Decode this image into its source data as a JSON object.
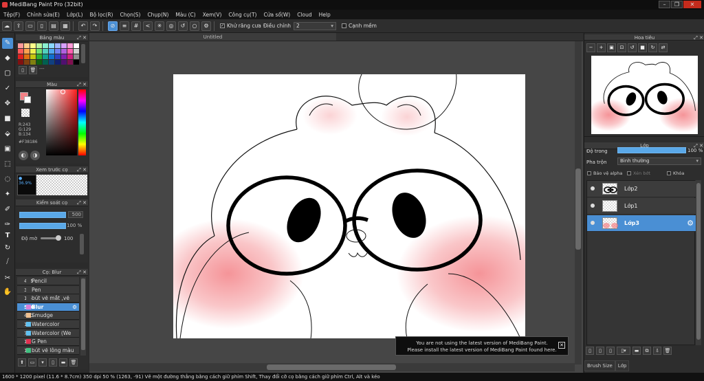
{
  "app": {
    "title": "MediBang Paint Pro (32bit)",
    "window_buttons": [
      "–",
      "❐",
      "✕"
    ]
  },
  "menu": [
    "Tệp(F)",
    "Chỉnh sửa(E)",
    "Lớp(L)",
    "Bộ lọc(R)",
    "Chọn(S)",
    "Chụp(N)",
    "Màu (C)",
    "Xem(V)",
    "Công cụ(T)",
    "Cửa sổ(W)",
    "Cloud",
    "Help"
  ],
  "toolbar": {
    "antialias_label": "Khử răng cưa",
    "correction_label": "Điều chỉnh",
    "correction_value": "2",
    "snap_label": "Cạnh mềm"
  },
  "color_panel": {
    "title": "Bảng màu",
    "swatches": [
      "#ff9a9a",
      "#ffd08a",
      "#ffff8a",
      "#b8f5a0",
      "#8af0d0",
      "#8ad8ff",
      "#a0b4ff",
      "#d8a0ff",
      "#ff9ad8",
      "#ffffff",
      "#ff5a5a",
      "#ffa050",
      "#f0f050",
      "#70e070",
      "#50d0c0",
      "#50a8f0",
      "#7080f0",
      "#b060e0",
      "#ff60b0",
      "#d0d0d0",
      "#e02020",
      "#e07010",
      "#c8c810",
      "#30b030",
      "#10a090",
      "#1070d0",
      "#3040c0",
      "#8020b0",
      "#d02080",
      "#909090",
      "#801010",
      "#804010",
      "#808010",
      "#106010",
      "#006050",
      "#104080",
      "#102070",
      "#501070",
      "#801050",
      "#000000"
    ]
  },
  "hue_panel": {
    "title": "Màu",
    "r": "R:243",
    "g": "G:129",
    "b": "B:134",
    "hex": "#F38186"
  },
  "preview_panel": {
    "title": "Xem trước cọ",
    "size": "36.9%"
  },
  "brush_control": {
    "title": "Kiểm soát cọ",
    "size_value": "500",
    "opacity_value": "100 %",
    "blur_label": "Độ mờ",
    "blur_value": "100"
  },
  "brush_list": {
    "title": "Cọ: Blur",
    "items": [
      {
        "size": "496",
        "name": "Pencil",
        "color": "#3a3a3a"
      },
      {
        "size": "3",
        "name": "Pen",
        "color": "#3a3a3a"
      },
      {
        "size": "1.5",
        "name": "bút vẽ mắt ,vẽ",
        "color": "#3a3a3a"
      },
      {
        "size": "500",
        "name": "Blur",
        "color": "#d880d8",
        "selected": true
      },
      {
        "size": "400",
        "name": "Smudge",
        "color": "#f0c090"
      },
      {
        "size": "10",
        "name": "Watercolor",
        "color": "#60c0f0"
      },
      {
        "size": "7",
        "name": "Watercolor (We",
        "color": "#60c0f0"
      },
      {
        "size": "15",
        "name": "G Pen",
        "color": "#e03050"
      },
      {
        "size": "10",
        "name": "bút vẽ lông màu",
        "color": "#40c080"
      }
    ]
  },
  "canvas": {
    "tab_title": "Untitled"
  },
  "toast": {
    "line1": "You are not using the latest version of MediBang Paint.",
    "line2": "Please install the latest version of MediBang Paint found here."
  },
  "navigator": {
    "title": "Hoa tiêu"
  },
  "layers": {
    "title": "Lớp",
    "opacity_label": "Độ trong",
    "opacity_value": "100 %",
    "blend_label": "Pha trộn",
    "blend_value": "Bình thường",
    "protect_alpha": "Bảo vệ alpha",
    "clipping": "Xén bớt",
    "lock": "Khóa",
    "items": [
      {
        "name": "Lớp2",
        "selected": false
      },
      {
        "name": "Lớp1",
        "selected": false
      },
      {
        "name": "Lớp3",
        "selected": true
      }
    ]
  },
  "bottom_tabs": [
    "Brush Size",
    "Lớp"
  ],
  "status": "1600 * 1200 pixel  (11.6 * 8.7cm)  350 dpi  50 %  (1263, -91)  Vẽ một đường thẳng bằng cách giữ phím Shift, Thay đổi cỡ cọ bằng cách giữ phím Ctrl, Alt và kéo",
  "colors": {
    "accent": "#4a8fd4",
    "blush": "#f38186"
  }
}
